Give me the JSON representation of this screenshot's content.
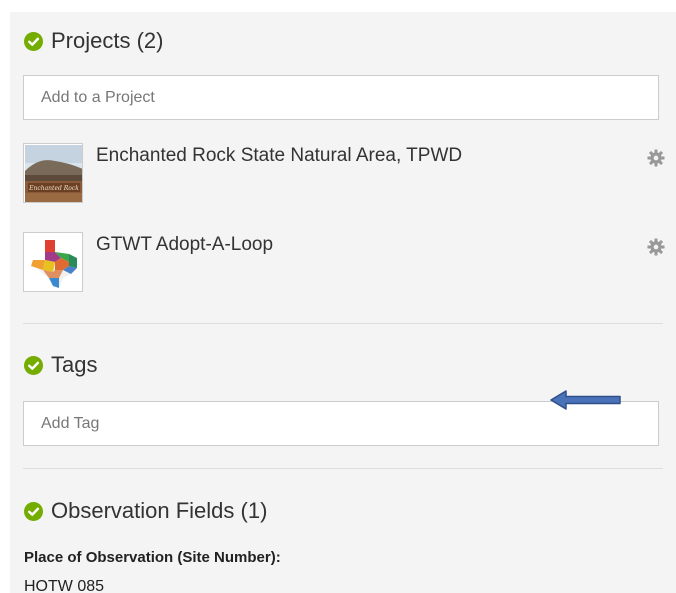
{
  "projects_section": {
    "title": "Projects (2)",
    "add_placeholder": "Add to a Project",
    "items": [
      {
        "title": "Enchanted Rock State Natural Area, TPWD",
        "thumb_text": "Enchanted Rock",
        "settings_icon": "gear-icon"
      },
      {
        "title": "GTWT Adopt-A-Loop",
        "thumb_icon": "texas-map-icon",
        "settings_icon": "gear-icon"
      }
    ]
  },
  "tags_section": {
    "title": "Tags",
    "add_placeholder": "Add Tag"
  },
  "observation_fields_section": {
    "title": "Observation Fields (1)",
    "fields": [
      {
        "label": "Place of Observation (Site Number):",
        "value": "HOTW 085"
      }
    ]
  },
  "colors": {
    "accent_green": "#74ac00",
    "panel_bg": "#f4f4f4",
    "gear_gray": "#999999",
    "arrow_blue": "#4a72b8"
  }
}
